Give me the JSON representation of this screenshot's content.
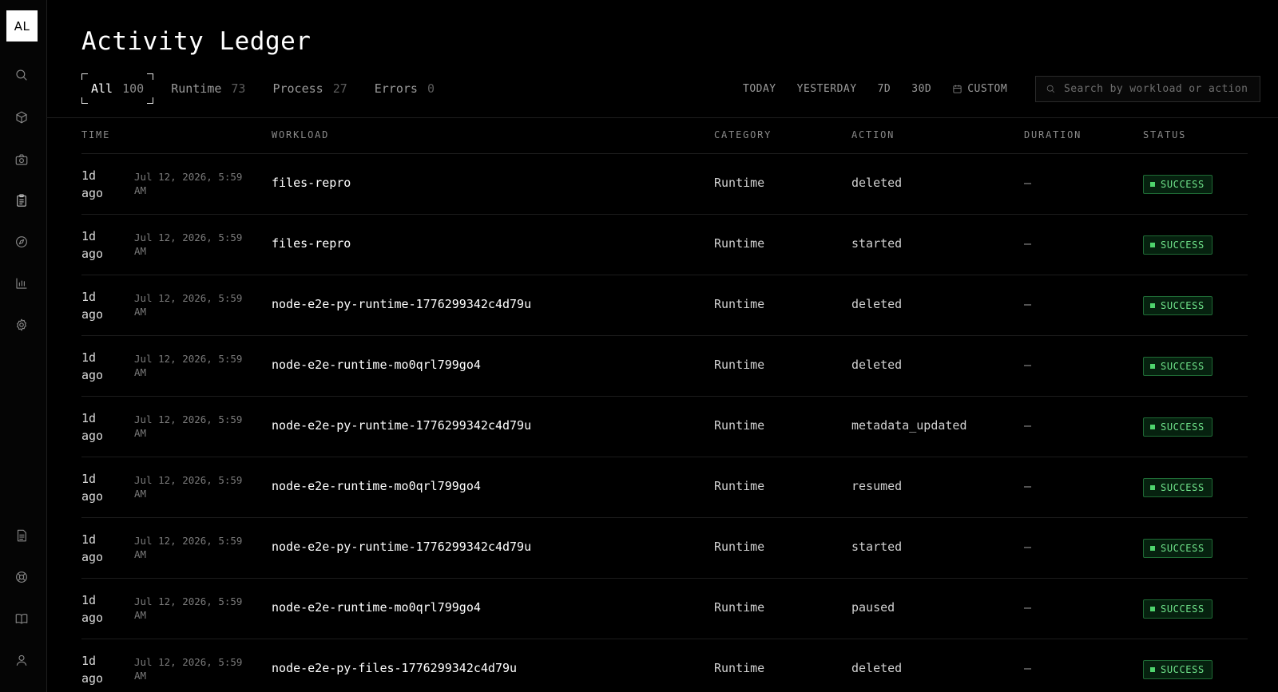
{
  "app": {
    "logo": "AL"
  },
  "sidebar": {
    "top_icons": [
      "search-icon",
      "box-icon",
      "camera-icon",
      "clipboard-icon",
      "compass-icon",
      "bar-chart-icon",
      "settings-icon"
    ],
    "bottom_icons": [
      "document-icon",
      "help-icon",
      "book-icon",
      "user-icon"
    ]
  },
  "page": {
    "title": "Activity Ledger"
  },
  "tabs": [
    {
      "label": "All",
      "count": "100",
      "active": true
    },
    {
      "label": "Runtime",
      "count": "73",
      "active": false
    },
    {
      "label": "Process",
      "count": "27",
      "active": false
    },
    {
      "label": "Errors",
      "count": "0",
      "active": false
    }
  ],
  "ranges": [
    "TODAY",
    "YESTERDAY",
    "7D",
    "30D"
  ],
  "custom_range": {
    "label": "CUSTOM",
    "icon": "calendar-icon"
  },
  "search": {
    "placeholder": "Search by workload or action",
    "value": ""
  },
  "columns": {
    "time": "TIME",
    "workload": "WORKLOAD",
    "category": "CATEGORY",
    "action": "ACTION",
    "duration": "DURATION",
    "status": "STATUS"
  },
  "rows": [
    {
      "rel": "1d\nago",
      "abs": "Jul 12, 2026, 5:59\nAM",
      "workload": "files-repro",
      "category": "Runtime",
      "action": "deleted",
      "duration": "—",
      "status": "SUCCESS"
    },
    {
      "rel": "1d\nago",
      "abs": "Jul 12, 2026, 5:59\nAM",
      "workload": "files-repro",
      "category": "Runtime",
      "action": "started",
      "duration": "—",
      "status": "SUCCESS"
    },
    {
      "rel": "1d\nago",
      "abs": "Jul 12, 2026, 5:59\nAM",
      "workload": "node-e2e-py-runtime-1776299342c4d79u",
      "category": "Runtime",
      "action": "deleted",
      "duration": "—",
      "status": "SUCCESS"
    },
    {
      "rel": "1d\nago",
      "abs": "Jul 12, 2026, 5:59\nAM",
      "workload": "node-e2e-runtime-mo0qrl799go4",
      "category": "Runtime",
      "action": "deleted",
      "duration": "—",
      "status": "SUCCESS"
    },
    {
      "rel": "1d\nago",
      "abs": "Jul 12, 2026, 5:59\nAM",
      "workload": "node-e2e-py-runtime-1776299342c4d79u",
      "category": "Runtime",
      "action": "metadata_updated",
      "duration": "—",
      "status": "SUCCESS"
    },
    {
      "rel": "1d\nago",
      "abs": "Jul 12, 2026, 5:59\nAM",
      "workload": "node-e2e-runtime-mo0qrl799go4",
      "category": "Runtime",
      "action": "resumed",
      "duration": "—",
      "status": "SUCCESS"
    },
    {
      "rel": "1d\nago",
      "abs": "Jul 12, 2026, 5:59\nAM",
      "workload": "node-e2e-py-runtime-1776299342c4d79u",
      "category": "Runtime",
      "action": "started",
      "duration": "—",
      "status": "SUCCESS"
    },
    {
      "rel": "1d\nago",
      "abs": "Jul 12, 2026, 5:59\nAM",
      "workload": "node-e2e-runtime-mo0qrl799go4",
      "category": "Runtime",
      "action": "paused",
      "duration": "—",
      "status": "SUCCESS"
    },
    {
      "rel": "1d\nago",
      "abs": "Jul 12, 2026, 5:59\nAM",
      "workload": "node-e2e-py-files-1776299342c4d79u",
      "category": "Runtime",
      "action": "deleted",
      "duration": "—",
      "status": "SUCCESS"
    }
  ],
  "colors": {
    "success": "#6fe38a",
    "background": "#000000"
  }
}
